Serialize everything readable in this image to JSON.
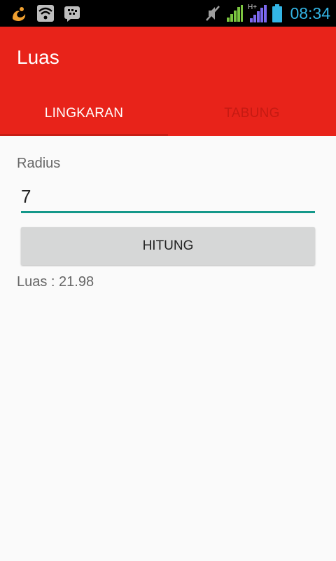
{
  "status_bar": {
    "time": "08:34",
    "network_type": "H+",
    "icons": [
      "uc-browser-icon",
      "wifi-icon",
      "bbm-icon",
      "mute-icon",
      "signal-icon",
      "signal-hplus-icon",
      "battery-icon"
    ]
  },
  "app_bar": {
    "title": "Luas",
    "color": "#e8231a"
  },
  "tabs": [
    {
      "label": "LINGKARAN",
      "active": true
    },
    {
      "label": "TABUNG",
      "active": false
    }
  ],
  "form": {
    "radius_label": "Radius",
    "radius_value": "7",
    "button_label": "HITUNG",
    "result": "Luas : 21.98"
  },
  "colors": {
    "accent": "#14988a",
    "status_clock": "#33b5e5"
  }
}
